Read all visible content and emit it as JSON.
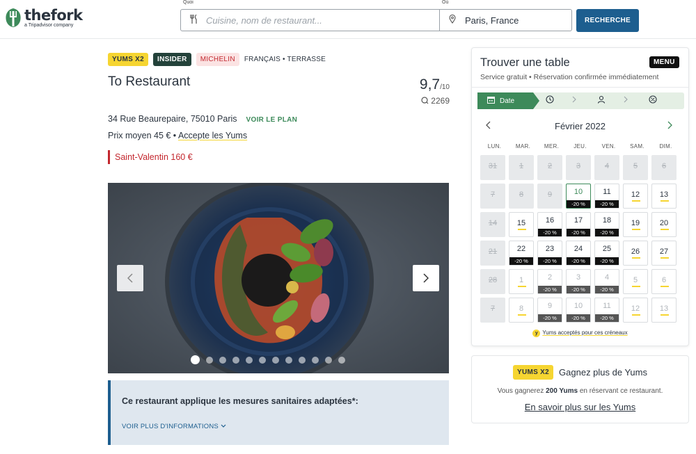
{
  "header": {
    "logo_word": "thefork",
    "logo_sub": "a Tripadvisor company",
    "what_label": "Quoi",
    "what_placeholder": "Cuisine, nom de restaurant...",
    "where_label": "Où",
    "where_value": "Paris, France",
    "search_label": "RECHERCHE"
  },
  "restaurant": {
    "badges": [
      "YUMS X2",
      "INSIDER",
      "MICHELIN"
    ],
    "cuisine": "FRANÇAIS • TERRASSE",
    "name": "To Restaurant",
    "score": "9,7",
    "score_out": "/10",
    "reviews": "2269",
    "address": "34 Rue Beaurepaire, 75010 Paris",
    "map_link": "VOIR LE PLAN",
    "price_prefix": "Prix moyen 45 € •",
    "accept_yums": "Accepte les Yums",
    "promo": "Saint-Valentin 160 €",
    "photo_count": 12,
    "photo_active": 0
  },
  "sanitary": {
    "title": "Ce restaurant applique les mesures sanitaires adaptées*:",
    "more": "VOIR PLUS D'INFORMATIONS"
  },
  "booking": {
    "title": "Trouver une table",
    "menu": "MENU",
    "subtitle": "Service gratuit • Réservation confirmée immédiatement",
    "step_date": "Date",
    "month": "Février 2022",
    "weekdays": [
      "LUN.",
      "MAR.",
      "MER.",
      "JEU.",
      "VEN.",
      "SAM.",
      "DIM."
    ],
    "weeks": [
      [
        {
          "d": "31",
          "s": "disabled"
        },
        {
          "d": "1",
          "s": "disabled"
        },
        {
          "d": "2",
          "s": "disabled"
        },
        {
          "d": "3",
          "s": "disabled"
        },
        {
          "d": "4",
          "s": "disabled"
        },
        {
          "d": "5",
          "s": "disabled"
        },
        {
          "d": "6",
          "s": "disabled"
        }
      ],
      [
        {
          "d": "7",
          "s": "disabled"
        },
        {
          "d": "8",
          "s": "disabled"
        },
        {
          "d": "9",
          "s": "disabled"
        },
        {
          "d": "10",
          "s": "selected",
          "disc": "-20 %"
        },
        {
          "d": "11",
          "s": "normal",
          "disc": "-20 %"
        },
        {
          "d": "12",
          "s": "normal",
          "yum": true
        },
        {
          "d": "13",
          "s": "normal",
          "yum": true
        }
      ],
      [
        {
          "d": "14",
          "s": "disabled"
        },
        {
          "d": "15",
          "s": "normal",
          "yum": true
        },
        {
          "d": "16",
          "s": "normal",
          "disc": "-20 %"
        },
        {
          "d": "17",
          "s": "normal",
          "disc": "-20 %"
        },
        {
          "d": "18",
          "s": "normal",
          "disc": "-20 %"
        },
        {
          "d": "19",
          "s": "normal",
          "yum": true
        },
        {
          "d": "20",
          "s": "normal",
          "yum": true
        }
      ],
      [
        {
          "d": "21",
          "s": "disabled"
        },
        {
          "d": "22",
          "s": "normal",
          "disc": "-20 %"
        },
        {
          "d": "23",
          "s": "normal",
          "disc": "-20 %"
        },
        {
          "d": "24",
          "s": "normal",
          "disc": "-20 %"
        },
        {
          "d": "25",
          "s": "normal",
          "disc": "-20 %"
        },
        {
          "d": "26",
          "s": "normal",
          "yum": true
        },
        {
          "d": "27",
          "s": "normal",
          "yum": true
        }
      ],
      [
        {
          "d": "28",
          "s": "disabled"
        },
        {
          "d": "1",
          "s": "faded",
          "yum": true
        },
        {
          "d": "2",
          "s": "faded",
          "disc": "-20 %"
        },
        {
          "d": "3",
          "s": "faded",
          "disc": "-20 %"
        },
        {
          "d": "4",
          "s": "faded",
          "disc": "-20 %"
        },
        {
          "d": "5",
          "s": "faded",
          "yum": true
        },
        {
          "d": "6",
          "s": "faded",
          "yum": true
        }
      ],
      [
        {
          "d": "7",
          "s": "disabled"
        },
        {
          "d": "8",
          "s": "faded",
          "yum": true
        },
        {
          "d": "9",
          "s": "faded",
          "disc": "-20 %"
        },
        {
          "d": "10",
          "s": "faded",
          "disc": "-20 %"
        },
        {
          "d": "11",
          "s": "faded",
          "disc": "-20 %"
        },
        {
          "d": "12",
          "s": "faded",
          "yum": true
        },
        {
          "d": "13",
          "s": "faded",
          "yum": true
        }
      ]
    ],
    "yums_note_icon": "y",
    "yums_note": "Yums acceptés pour ces créneaux"
  },
  "yums_panel": {
    "badge": "YUMS X2",
    "title": "Gagnez plus de Yums",
    "sub_prefix": "Vous gagnerez",
    "sub_amount": "200 Yums",
    "sub_suffix": "en réservant ce restaurant.",
    "link": "En savoir plus sur les Yums"
  },
  "colors": {
    "brand_green": "#3d8a5a",
    "search_blue": "#1d5e8f",
    "yums_yellow": "#f6d531",
    "michelin_red": "#c3272e"
  },
  "icons": {
    "what": "cutlery-icon",
    "where": "location-pin-icon",
    "calendar": "calendar-icon",
    "time": "clock-icon",
    "people": "person-icon",
    "offer": "percent-icon"
  }
}
